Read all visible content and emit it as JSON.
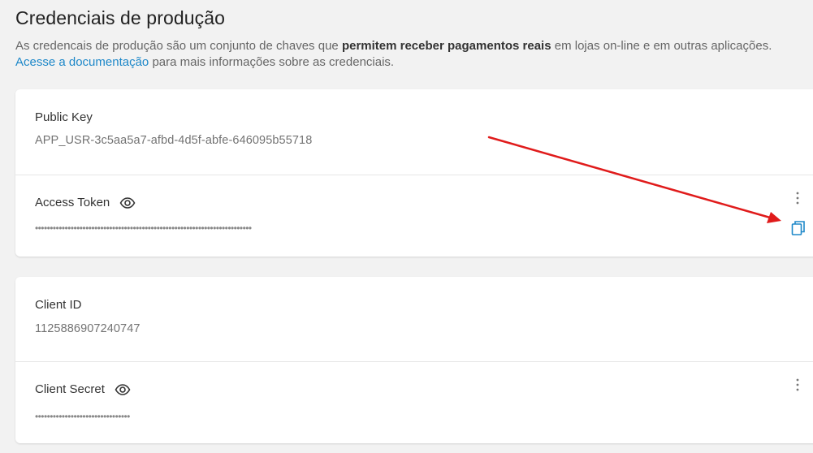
{
  "header": {
    "title": "Credenciais de produção",
    "intro_start": "As credencais de produção são um conjunto de chaves que ",
    "intro_bold": "permitem receber pagamentos reais",
    "intro_end": " em lojas on-line e em outras aplicações.",
    "doc_link": "Acesse a documentação",
    "doc_suffix": " para mais informações sobre as credenciais."
  },
  "credentials": {
    "public_key": {
      "label": "Public Key",
      "value": "APP_USR-3c5aa5a7-afbd-4d5f-abfe-646095b55718"
    },
    "access_token": {
      "label": "Access Token",
      "value": "•••••••••••••••••••••••••••••••••••••••••••••••••••••••••••••••••••••••••"
    },
    "client_id": {
      "label": "Client ID",
      "value": "1125886907240747"
    },
    "client_secret": {
      "label": "Client Secret",
      "value": "••••••••••••••••••••••••••••••••"
    }
  },
  "icons": {
    "eye": "eye-icon",
    "copy": "copy-icon",
    "more": "more-vertical-icon"
  },
  "colors": {
    "link": "#1e88c9",
    "copy_icon": "#1e88c9",
    "annotation_arrow": "#e01b1b",
    "background": "#f2f2f2"
  }
}
